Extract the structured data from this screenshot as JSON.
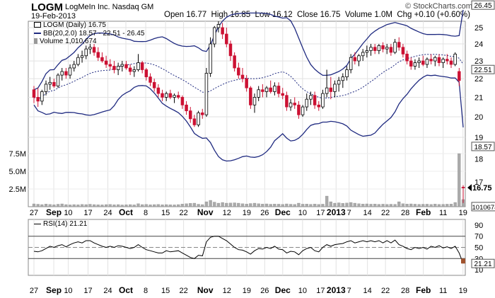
{
  "header": {
    "ticker": "LOGM",
    "company": "LogMeIn Inc.  Nasdaq GM",
    "date": "19-Feb-2013",
    "open_label": "Open",
    "open": "16.77",
    "high_label": "High",
    "high": "16.85",
    "low_label": "Low",
    "low": "16.12",
    "close_label": "Close",
    "close": "16.75",
    "volume_label": "Volume",
    "volume": "1.0M",
    "chg_label": "Chg",
    "chg": "+0.10 (+0.60%)",
    "credit": "© StockCharts.com"
  },
  "legend": {
    "price": "LOGM (Daily) 16.75",
    "bb": "BB(20,2.0) 18.57 - 22.51 - 26.45",
    "volume": "Volume 1,010,674",
    "rsi": "RSI(14) 21.21"
  },
  "colors": {
    "up": "#ffffff",
    "down": "#cc1133",
    "candle_edge": "#000000",
    "bb": "#1f2a80",
    "volume": "#aaaaaa",
    "rsi": "#000000"
  },
  "chart_data": [
    {
      "type": "candlestick",
      "ylim": [
        18.6,
        26.0
      ],
      "y_ticks": [
        19,
        20,
        21,
        22,
        23,
        24,
        25
      ],
      "scale": "log",
      "x_ticks": [
        "27",
        "Sep",
        "10",
        "17",
        "24",
        "Oct",
        "8",
        "15",
        "22",
        "Nov",
        "12",
        "19",
        "26",
        "Dec",
        "10",
        "17",
        "2013",
        "7",
        "14",
        "22",
        "28",
        "Feb",
        "11",
        "19"
      ],
      "x_tick_dates": [
        "Aug 27",
        "Sep 4",
        "Sep 10",
        "Sep 17",
        "Sep 24",
        "Oct 1",
        "Oct 8",
        "Oct 15",
        "Oct 22",
        "Nov 1",
        "Nov 12",
        "Nov 19",
        "Nov 26",
        "Dec 3",
        "Dec 10",
        "Dec 17",
        "Jan 2",
        "Jan 7",
        "Jan 14",
        "Jan 22",
        "Jan 28",
        "Feb 4",
        "Feb 11",
        "Feb 19"
      ],
      "last_close": 16.75,
      "markers": [
        {
          "label": "26.45",
          "value": 26.45,
          "series": "BB upper",
          "style": "box"
        },
        {
          "label": "22.51",
          "value": 22.51,
          "series": "BB middle",
          "style": "box"
        },
        {
          "label": "18.57",
          "value": 18.57,
          "series": "BB lower",
          "style": "box"
        },
        {
          "label": "16.75",
          "value": 16.75,
          "series": "Close",
          "style": "bold"
        }
      ],
      "candles": [
        [
          21.4,
          21.6,
          20.7,
          21.0
        ],
        [
          21.0,
          21.5,
          20.5,
          20.8
        ],
        [
          20.8,
          21.4,
          20.6,
          21.3
        ],
        [
          21.3,
          21.9,
          21.1,
          21.7
        ],
        [
          21.7,
          22.1,
          21.4,
          21.8
        ],
        [
          21.8,
          22.0,
          21.5,
          21.6
        ],
        [
          21.6,
          22.3,
          21.5,
          22.2
        ],
        [
          22.2,
          22.6,
          21.9,
          22.4
        ],
        [
          22.4,
          22.6,
          22.0,
          22.2
        ],
        [
          22.2,
          22.8,
          22.0,
          22.6
        ],
        [
          22.6,
          23.0,
          22.4,
          22.8
        ],
        [
          22.8,
          23.4,
          22.7,
          23.2
        ],
        [
          23.2,
          23.6,
          22.9,
          23.3
        ],
        [
          23.3,
          23.9,
          23.1,
          23.7
        ],
        [
          23.7,
          24.0,
          23.4,
          23.8
        ],
        [
          23.8,
          24.0,
          23.3,
          23.5
        ],
        [
          23.5,
          23.8,
          23.0,
          23.2
        ],
        [
          23.2,
          23.5,
          22.9,
          23.0
        ],
        [
          23.0,
          23.3,
          22.6,
          22.8
        ],
        [
          22.8,
          23.1,
          22.5,
          22.7
        ],
        [
          22.7,
          23.0,
          22.3,
          22.5
        ],
        [
          22.5,
          22.9,
          22.2,
          22.7
        ],
        [
          22.7,
          23.0,
          22.4,
          22.8
        ],
        [
          22.8,
          23.0,
          22.5,
          22.6
        ],
        [
          22.6,
          22.8,
          22.2,
          22.4
        ],
        [
          22.4,
          22.7,
          22.1,
          22.5
        ],
        [
          22.5,
          23.4,
          22.4,
          22.9
        ],
        [
          22.9,
          23.0,
          22.3,
          22.5
        ],
        [
          22.5,
          22.6,
          21.9,
          22.1
        ],
        [
          22.1,
          22.3,
          21.6,
          21.8
        ],
        [
          21.8,
          22.0,
          21.3,
          21.5
        ],
        [
          21.5,
          21.7,
          21.0,
          21.2
        ],
        [
          21.2,
          21.4,
          20.8,
          21.0
        ],
        [
          21.0,
          21.3,
          20.8,
          21.2
        ],
        [
          21.2,
          21.4,
          20.9,
          21.0
        ],
        [
          21.0,
          21.2,
          20.7,
          21.1
        ],
        [
          21.1,
          21.3,
          20.9,
          21.0
        ],
        [
          21.0,
          21.1,
          20.4,
          20.6
        ],
        [
          20.6,
          20.8,
          20.1,
          20.3
        ],
        [
          20.3,
          20.5,
          19.7,
          19.9
        ],
        [
          19.9,
          20.1,
          19.5,
          19.6
        ],
        [
          19.6,
          20.3,
          19.5,
          20.2
        ],
        [
          20.2,
          20.4,
          19.9,
          20.1
        ],
        [
          20.1,
          22.6,
          20.0,
          22.3
        ],
        [
          22.3,
          24.4,
          22.1,
          24.0
        ],
        [
          24.0,
          25.1,
          23.8,
          25.0
        ],
        [
          25.0,
          25.4,
          24.7,
          25.2
        ],
        [
          25.0,
          25.3,
          24.3,
          24.6
        ],
        [
          24.6,
          25.0,
          23.8,
          24.0
        ],
        [
          24.0,
          24.2,
          23.0,
          23.3
        ],
        [
          23.3,
          23.5,
          22.4,
          22.6
        ],
        [
          22.6,
          22.9,
          22.0,
          22.2
        ],
        [
          22.2,
          22.6,
          21.8,
          22.0
        ],
        [
          22.0,
          22.2,
          21.3,
          21.5
        ],
        [
          21.5,
          21.6,
          20.4,
          20.6
        ],
        [
          20.6,
          21.2,
          20.2,
          21.0
        ],
        [
          21.0,
          21.6,
          20.8,
          21.4
        ],
        [
          21.4,
          21.7,
          21.0,
          21.3
        ],
        [
          21.3,
          21.6,
          21.0,
          21.5
        ],
        [
          21.5,
          21.9,
          21.2,
          21.3
        ],
        [
          21.3,
          21.8,
          21.1,
          21.6
        ],
        [
          21.6,
          21.8,
          21.0,
          21.2
        ],
        [
          21.2,
          21.5,
          20.9,
          21.1
        ],
        [
          21.1,
          21.3,
          20.3,
          20.5
        ],
        [
          20.5,
          20.9,
          20.3,
          20.7
        ],
        [
          20.7,
          21.0,
          20.4,
          20.6
        ],
        [
          20.6,
          20.8,
          19.9,
          20.1
        ],
        [
          20.1,
          20.6,
          20.0,
          20.5
        ],
        [
          20.5,
          21.2,
          20.3,
          20.9
        ],
        [
          20.9,
          21.3,
          20.6,
          21.1
        ],
        [
          21.1,
          21.3,
          20.4,
          20.6
        ],
        [
          20.6,
          20.8,
          20.3,
          20.5
        ],
        [
          20.5,
          21.4,
          20.4,
          21.2
        ],
        [
          21.2,
          22.5,
          21.0,
          21.5
        ],
        [
          21.5,
          22.1,
          20.9,
          21.3
        ],
        [
          21.3,
          21.9,
          21.0,
          21.7
        ],
        [
          21.7,
          22.1,
          21.3,
          21.9
        ],
        [
          21.9,
          22.3,
          21.5,
          22.1
        ],
        [
          22.1,
          22.7,
          21.9,
          22.5
        ],
        [
          22.5,
          23.4,
          22.3,
          23.2
        ],
        [
          23.2,
          23.5,
          22.8,
          23.0
        ],
        [
          23.0,
          23.4,
          22.7,
          23.3
        ],
        [
          23.3,
          23.7,
          23.0,
          23.5
        ],
        [
          23.5,
          23.9,
          23.2,
          23.6
        ],
        [
          23.6,
          24.0,
          23.3,
          23.8
        ],
        [
          23.8,
          24.0,
          23.4,
          23.6
        ],
        [
          23.6,
          24.0,
          23.4,
          23.9
        ],
        [
          23.9,
          24.1,
          23.5,
          23.7
        ],
        [
          23.7,
          24.0,
          23.4,
          23.8
        ],
        [
          23.8,
          24.0,
          23.3,
          23.5
        ],
        [
          23.5,
          24.3,
          23.4,
          24.1
        ],
        [
          24.1,
          24.4,
          23.6,
          23.8
        ],
        [
          23.8,
          24.0,
          23.2,
          23.4
        ],
        [
          23.4,
          23.6,
          22.8,
          23.0
        ],
        [
          23.0,
          23.2,
          22.5,
          22.7
        ],
        [
          22.7,
          23.1,
          22.5,
          22.9
        ],
        [
          22.9,
          23.2,
          22.6,
          23.0
        ],
        [
          23.0,
          23.3,
          22.7,
          22.8
        ],
        [
          22.8,
          23.2,
          22.6,
          23.1
        ],
        [
          23.1,
          23.4,
          22.8,
          23.0
        ],
        [
          23.0,
          23.3,
          22.7,
          23.2
        ],
        [
          23.2,
          23.4,
          22.7,
          22.9
        ],
        [
          22.9,
          23.2,
          22.6,
          23.1
        ],
        [
          23.1,
          23.4,
          22.8,
          23.0
        ],
        [
          23.0,
          23.2,
          22.6,
          22.8
        ],
        [
          22.8,
          23.5,
          22.7,
          23.4
        ],
        [
          22.4,
          22.6,
          21.6,
          21.9
        ],
        [
          16.77,
          16.85,
          16.12,
          16.75
        ]
      ]
    },
    {
      "type": "bar",
      "series": "Volume",
      "ylim": [
        0,
        9000000
      ],
      "y_tick_labels": [
        "2.5M",
        "5.0M",
        "7.5M"
      ],
      "y_tick_values": [
        2500000,
        5000000,
        7500000
      ],
      "values": [
        400000,
        350000,
        300000,
        380000,
        320000,
        280000,
        350000,
        400000,
        300000,
        260000,
        300000,
        280000,
        320000,
        300000,
        350000,
        300000,
        280000,
        260000,
        300000,
        320000,
        280000,
        300000,
        250000,
        280000,
        300000,
        260000,
        420000,
        300000,
        330000,
        280000,
        300000,
        320000,
        280000,
        300000,
        280000,
        260000,
        300000,
        380000,
        420000,
        480000,
        500000,
        350000,
        300000,
        700000,
        900000,
        650000,
        500000,
        600000,
        500000,
        520000,
        550000,
        500000,
        420000,
        380000,
        450000,
        500000,
        420000,
        380000,
        400000,
        350000,
        380000,
        360000,
        330000,
        400000,
        350000,
        320000,
        500000,
        360000,
        380000,
        340000,
        380000,
        320000,
        360000,
        1500000,
        700000,
        500000,
        550000,
        480000,
        520000,
        600000,
        500000,
        420000,
        380000,
        400000,
        360000,
        380000,
        340000,
        360000,
        330000,
        350000,
        340000,
        700000,
        420000,
        380000,
        400000,
        360000,
        340000,
        350000,
        360000,
        320000,
        380000,
        330000,
        340000,
        360000,
        380000,
        600000,
        7500000,
        1010674
      ],
      "last_value_label": "1010674"
    },
    {
      "type": "line",
      "series": "RSI(14)",
      "ylim": [
        0,
        100
      ],
      "y_ticks": [
        10,
        30,
        50,
        70,
        90
      ],
      "reference_lines": [
        30,
        50,
        70
      ],
      "last_value_label": "21.21",
      "values": [
        43,
        42,
        44,
        48,
        52,
        50,
        53,
        55,
        51,
        55,
        58,
        60,
        58,
        62,
        62,
        58,
        55,
        52,
        50,
        52,
        50,
        53,
        52,
        50,
        48,
        50,
        55,
        50,
        46,
        44,
        42,
        40,
        40,
        44,
        42,
        43,
        44,
        40,
        36,
        32,
        30,
        36,
        35,
        60,
        68,
        70,
        70,
        66,
        62,
        56,
        50,
        46,
        45,
        42,
        38,
        44,
        48,
        47,
        50,
        48,
        52,
        47,
        46,
        40,
        43,
        42,
        37,
        44,
        48,
        50,
        44,
        42,
        50,
        55,
        52,
        55,
        56,
        57,
        60,
        62,
        58,
        60,
        62,
        60,
        62,
        60,
        62,
        58,
        62,
        58,
        63,
        55,
        52,
        48,
        46,
        50,
        48,
        50,
        47,
        52,
        50,
        53,
        49,
        51,
        48,
        52,
        40,
        21.21
      ]
    }
  ]
}
